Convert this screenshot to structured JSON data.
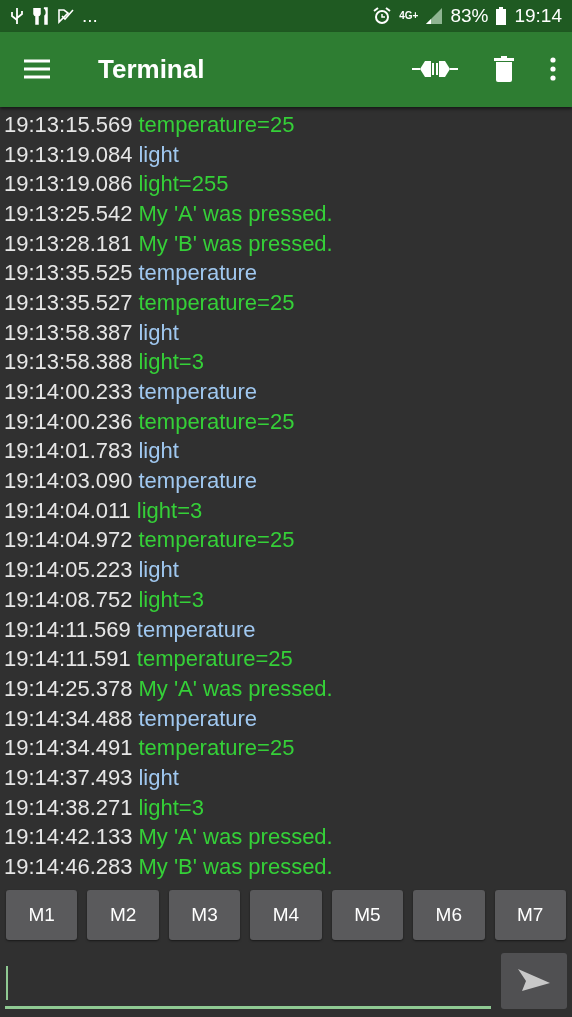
{
  "status_bar": {
    "more": "...",
    "network": "4G+",
    "battery": "83%",
    "time": "19:14"
  },
  "toolbar": {
    "title": "Terminal"
  },
  "log": [
    {
      "time": "19:13:15.569",
      "text": "temperature=25",
      "kind": "received"
    },
    {
      "time": "19:13:19.084",
      "text": "light",
      "kind": "sent"
    },
    {
      "time": "19:13:19.086",
      "text": "light=255",
      "kind": "received"
    },
    {
      "time": "19:13:25.542",
      "text": "My 'A' was pressed.",
      "kind": "received"
    },
    {
      "time": "19:13:28.181",
      "text": "My 'B' was pressed.",
      "kind": "received"
    },
    {
      "time": "19:13:35.525",
      "text": "temperature",
      "kind": "sent"
    },
    {
      "time": "19:13:35.527",
      "text": "temperature=25",
      "kind": "received"
    },
    {
      "time": "19:13:58.387",
      "text": "light",
      "kind": "sent"
    },
    {
      "time": "19:13:58.388",
      "text": "light=3",
      "kind": "received"
    },
    {
      "time": "19:14:00.233",
      "text": "temperature",
      "kind": "sent"
    },
    {
      "time": "19:14:00.236",
      "text": "temperature=25",
      "kind": "received"
    },
    {
      "time": "19:14:01.783",
      "text": "light",
      "kind": "sent"
    },
    {
      "time": "19:14:03.090",
      "text": "temperature",
      "kind": "sent"
    },
    {
      "time": "19:14:04.011",
      "text": "light=3",
      "kind": "received"
    },
    {
      "time": "19:14:04.972",
      "text": "temperature=25",
      "kind": "received"
    },
    {
      "time": "19:14:05.223",
      "text": "light",
      "kind": "sent"
    },
    {
      "time": "19:14:08.752",
      "text": "light=3",
      "kind": "received"
    },
    {
      "time": "19:14:11.569",
      "text": "temperature",
      "kind": "sent"
    },
    {
      "time": "19:14:11.591",
      "text": "temperature=25",
      "kind": "received"
    },
    {
      "time": "19:14:25.378",
      "text": "My 'A' was pressed.",
      "kind": "received"
    },
    {
      "time": "19:14:34.488",
      "text": "temperature",
      "kind": "sent"
    },
    {
      "time": "19:14:34.491",
      "text": "temperature=25",
      "kind": "received"
    },
    {
      "time": "19:14:37.493",
      "text": "light",
      "kind": "sent"
    },
    {
      "time": "19:14:38.271",
      "text": "light=3",
      "kind": "received"
    },
    {
      "time": "19:14:42.133",
      "text": "My 'A' was pressed.",
      "kind": "received"
    },
    {
      "time": "19:14:46.283",
      "text": "My 'B' was pressed.",
      "kind": "received"
    }
  ],
  "macro_buttons": [
    "M1",
    "M2",
    "M3",
    "M4",
    "M5",
    "M6",
    "M7"
  ]
}
